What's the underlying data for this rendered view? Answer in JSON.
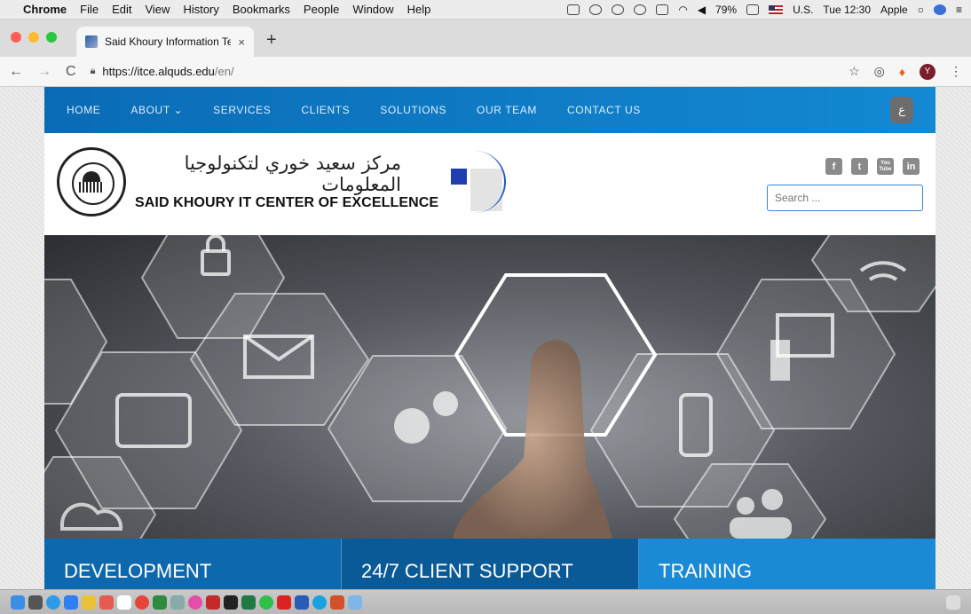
{
  "menubar": {
    "app_name": "Chrome",
    "items": [
      "File",
      "Edit",
      "View",
      "History",
      "Bookmarks",
      "People",
      "Window",
      "Help"
    ],
    "battery": "79%",
    "input_source": "U.S.",
    "clock": "Tue 12:30",
    "user": "Apple"
  },
  "tab": {
    "title": "Said Khoury Information Techn",
    "close": "×",
    "new_tab": "+"
  },
  "toolbar": {
    "back": "←",
    "forward": "→",
    "reload": "C",
    "url_scheme_host": "https://itce.alquds.edu",
    "url_path": "/en/",
    "star": "☆",
    "avatar_letter": "Y",
    "menu": "⋮"
  },
  "site": {
    "nav": [
      "HOME",
      "ABOUT ⌄",
      "SERVICES",
      "CLIENTS",
      "SOLUTIONS",
      "OUR TEAM",
      "CONTACT US"
    ],
    "lang_button": "ع",
    "logo_arabic": "مركز سعيد خوري لتكنولوجيا المعلومات",
    "logo_english": "SAID KHOURY IT CENTER OF EXCELLENCE",
    "seal_text": "AL-QUDS UNIVERSITY",
    "socials": [
      "f",
      "t",
      "You Tube",
      "in"
    ],
    "search_placeholder": "Search ...",
    "tiles": [
      "DEVELOPMENT",
      "24/7 CLIENT SUPPORT",
      "TRAINING"
    ]
  },
  "colors": {
    "nav_blue": "#0a6bb5",
    "tile_blue": "#0d68ad",
    "search_border": "#3a86d2"
  },
  "icons": [
    "apple-icon",
    "lock-icon",
    "mail-icon",
    "tablet-icon",
    "gear-icon",
    "phone-icon",
    "desktop-icon",
    "wifi-icon",
    "cloud-icon",
    "people-icon",
    "headset-icon"
  ]
}
